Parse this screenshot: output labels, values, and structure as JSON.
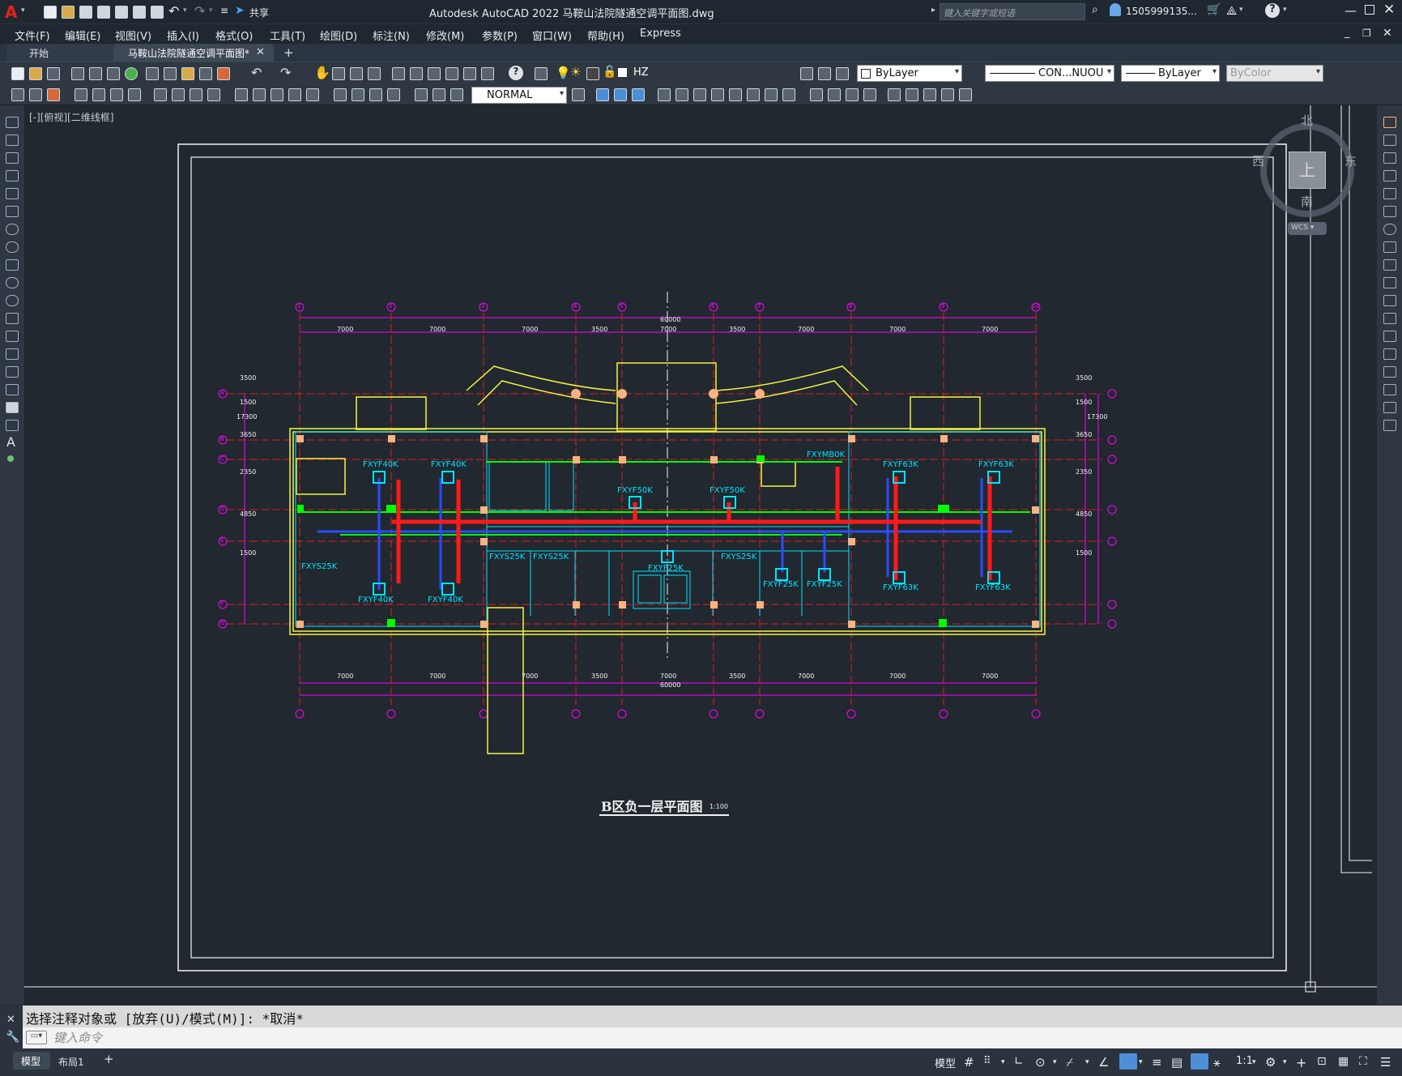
{
  "app": {
    "title": "Autodesk AutoCAD 2022    马鞍山法院隧通空调平面图.dwg",
    "share_label": "共享",
    "search_placeholder": "键入关键字或短语",
    "user": "1505999135...",
    "logo": "A"
  },
  "menu": [
    "文件(F)",
    "编辑(E)",
    "视图(V)",
    "插入(I)",
    "格式(O)",
    "工具(T)",
    "绘图(D)",
    "标注(N)",
    "修改(M)",
    "参数(P)",
    "窗口(W)",
    "帮助(H)",
    "Express"
  ],
  "tabs": [
    {
      "label": "开始"
    },
    {
      "label": "马鞍山法院隧通空调平面图*"
    }
  ],
  "toolbar": {
    "layer": "HZ",
    "color": "ByLayer",
    "linetype": "CON...NUOU",
    "lineweight": "ByLayer",
    "plotstyle": "ByColor",
    "dimstyle": "NORMAL"
  },
  "viewport": {
    "label": "[-][俯视][二维线框]",
    "viewcube": {
      "north": "北",
      "south": "南",
      "east": "东",
      "west": "西",
      "top": "上",
      "wcs": "WCS"
    }
  },
  "drawing": {
    "title": "B区负一层平面图",
    "scale": "1:100",
    "total_dim": "60000",
    "bay_dims": [
      "7000",
      "7000",
      "7000",
      "3500",
      "7000",
      "3500",
      "7000",
      "7000",
      "7000"
    ],
    "side_dims": [
      "3500",
      "1500",
      "3650",
      "2350",
      "4850",
      "1500"
    ],
    "side_total": "17300",
    "units": [
      "FXYF40K",
      "FXYF40K",
      "FXYF40K",
      "FXYF40K",
      "FXYF50K",
      "FXYF50K",
      "FXYF63K",
      "FXYF63K",
      "FXYF63K",
      "FXYF63K",
      "FXYS25K",
      "FXYS25K",
      "FXYS25K",
      "FXYS25K",
      "FXYF25K",
      "FXYF25K",
      "FXYF25K",
      "FXYMB0K"
    ],
    "grid_top": [
      "1",
      "2",
      "3",
      "4",
      "5",
      "6",
      "7",
      "8",
      "9",
      "10"
    ],
    "grid_side": [
      "A",
      "B",
      "C",
      "D",
      "E",
      "F",
      "G"
    ]
  },
  "command": {
    "history": "选择注释对象或 [放弃(U)/模式(M)]: *取消*",
    "placeholder": "键入命令"
  },
  "status": {
    "layout_tabs": [
      "模型",
      "布局1"
    ],
    "model_label": "模型",
    "scale": "1:1"
  }
}
